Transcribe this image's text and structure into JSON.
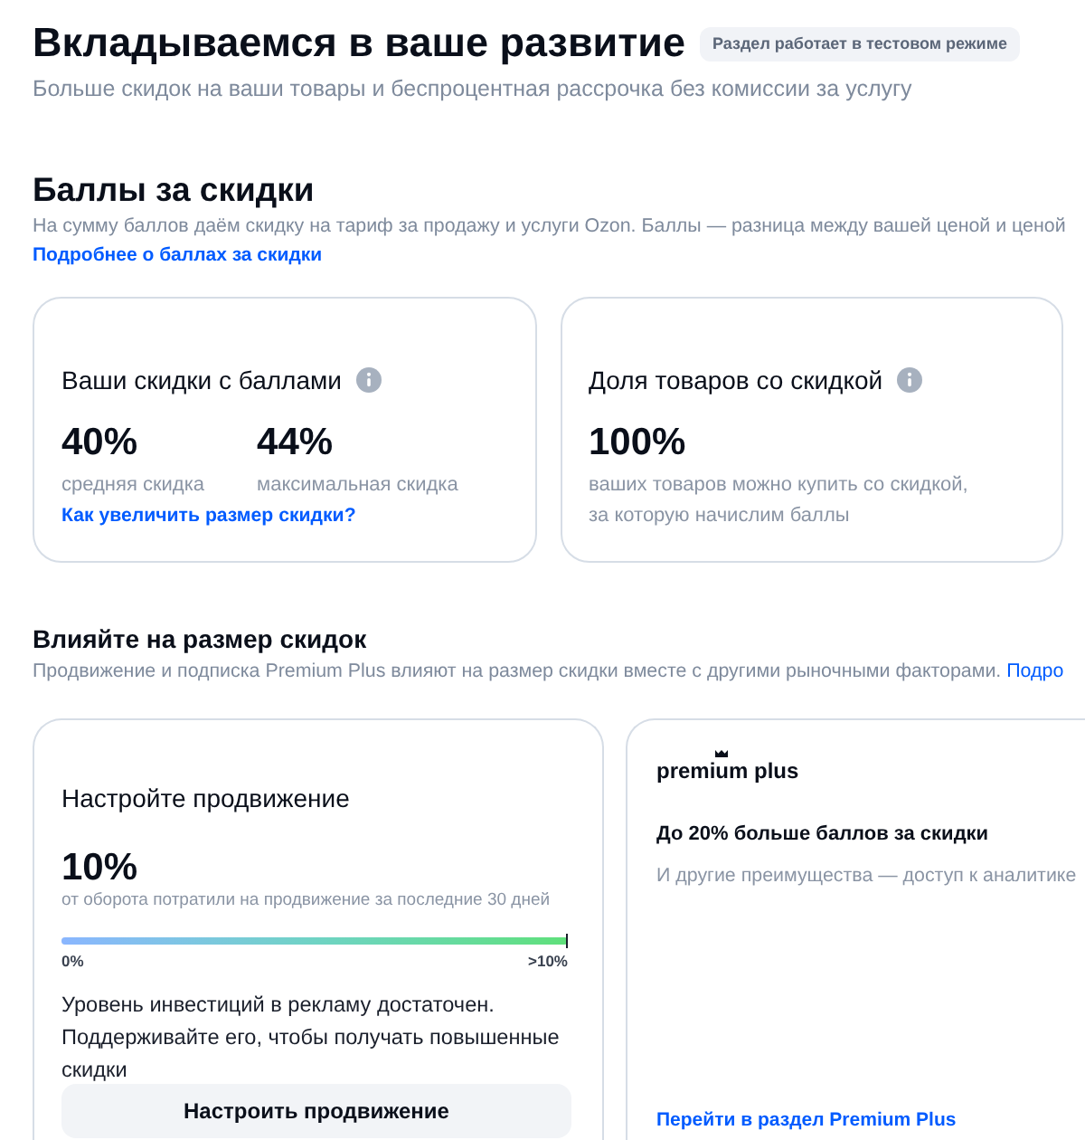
{
  "header": {
    "title": "Вкладываемся в ваше развитие",
    "badge": "Раздел работает в тестовом режиме",
    "subtitle": "Больше скидок на ваши товары и беспроцентная рассрочка без комиссии за услугу"
  },
  "points": {
    "title": "Баллы за скидки",
    "description": "На сумму баллов даём скидку на тариф за продажу и услуги Ozon. Баллы — разница между вашей ценой и ценой",
    "link": "Подробнее о баллах за скидки"
  },
  "point_cards": [
    {
      "title": "Ваши скидки с баллами",
      "stats": [
        {
          "value": "40%",
          "label": "средняя скидка"
        },
        {
          "value": "44%",
          "label": "максимальная скидка"
        }
      ],
      "link": "Как увеличить размер скидки?"
    },
    {
      "title": "Доля товаров со скидкой",
      "stats": [
        {
          "value": "100%",
          "label": "ваших товаров можно купить со скидкой,\nза которую начислим баллы"
        }
      ]
    }
  ],
  "influence": {
    "title": "Влияйте на размер скидок",
    "description": "Продвижение и подписка Premium Plus влияют на размер скидки вместе с другими рыночными факторами.",
    "link": "Подро"
  },
  "promotion_card": {
    "title": "Настройте продвижение",
    "value": "10%",
    "caption": "от оборота потратили на продвижение за последние 30 дней",
    "progress": {
      "level": 1,
      "min_label": "0%",
      "max_label": ">10%"
    },
    "message": "Уровень инвестиций в рекламу достаточен. Поддерживайте его, чтобы получать повышенные скидки",
    "button": "Настроить продвижение"
  },
  "premium_card": {
    "logo": "premium plus",
    "title": "До 20% больше баллов за скидки",
    "description": "И другие преимущества — доступ к аналитике",
    "link": "Перейти в раздел Premium Plus"
  }
}
